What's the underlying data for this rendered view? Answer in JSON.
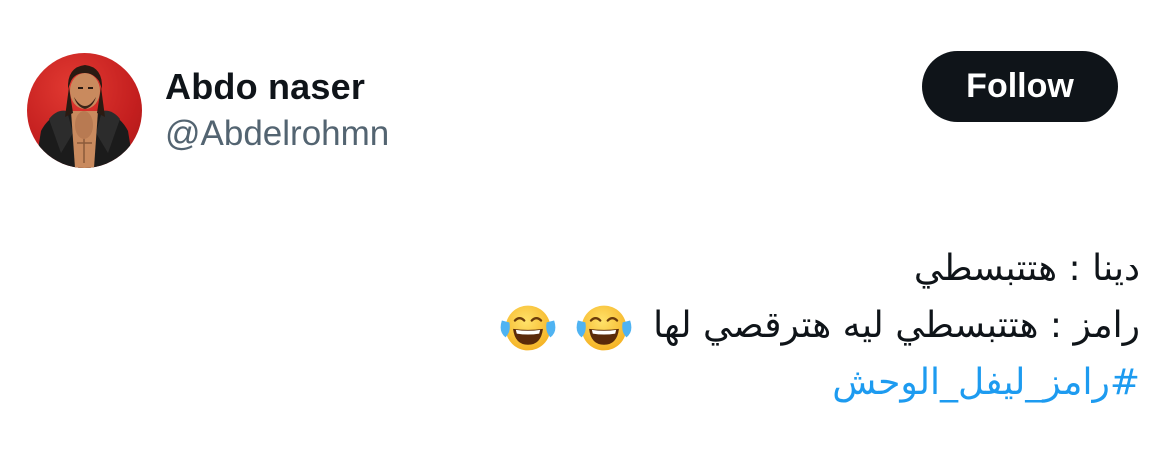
{
  "author": {
    "name": "Abdo naser",
    "handle": "@Abdelrohmn",
    "avatar_bg": "#c41f1f"
  },
  "follow_label": "Follow",
  "tweet": {
    "line1": "دينا : هتتبسطي",
    "line2": "رامز : هتتبسطي ليه هترقصي لها",
    "line2_emojis": [
      "face-with-tears-of-joy-icon",
      "face-with-tears-of-joy-icon"
    ],
    "hashtag": "#رامز_ليفل_الوحش"
  },
  "colors": {
    "text": "#0f1419",
    "secondary": "#536471",
    "link": "#1d9bf0",
    "button_bg": "#0f1419"
  }
}
